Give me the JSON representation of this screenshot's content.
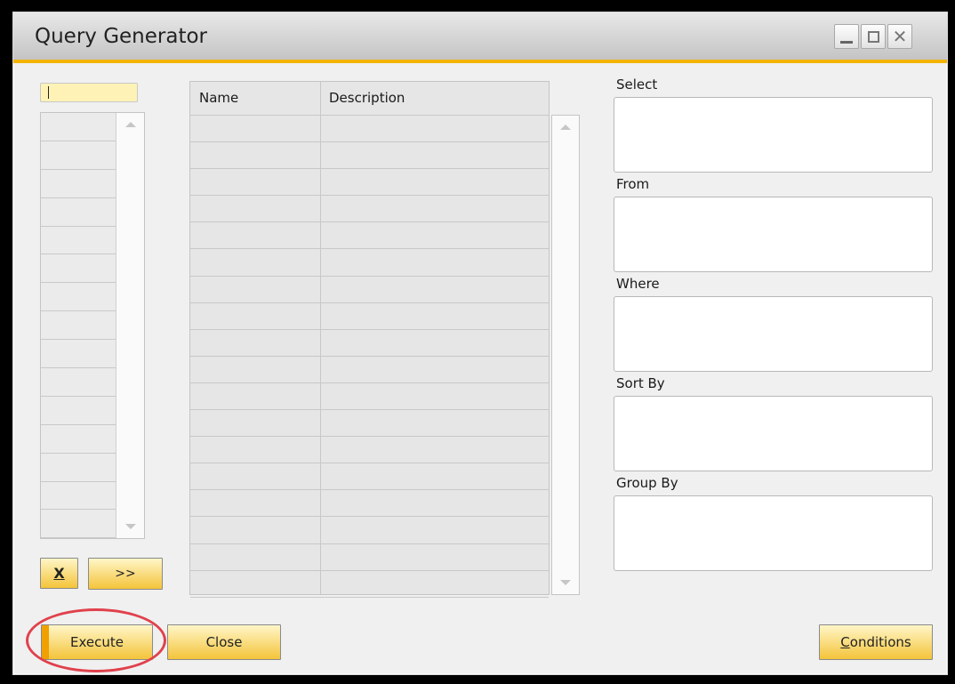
{
  "window": {
    "title": "Query Generator",
    "accent_color": "#f2b400",
    "controls": {
      "minimize_icon": "minimize-icon",
      "maximize_icon": "maximize-icon",
      "close_icon": "close-icon",
      "close_glyph": "✕"
    }
  },
  "tables_panel": {
    "search_value": "",
    "rows": 15
  },
  "left_buttons": {
    "remove_label": "X",
    "add_label": ">>"
  },
  "fields_grid": {
    "columns": [
      "Name",
      "Description"
    ],
    "rows": 18
  },
  "query_sections": {
    "select_label": "Select",
    "from_label": "From",
    "where_label": "Where",
    "sort_by_label": "Sort By",
    "group_by_label": "Group By"
  },
  "footer": {
    "execute_label": "Execute",
    "close_label": "Close",
    "conditions_label": "Conditions",
    "highlight_color": "#e0414c"
  }
}
